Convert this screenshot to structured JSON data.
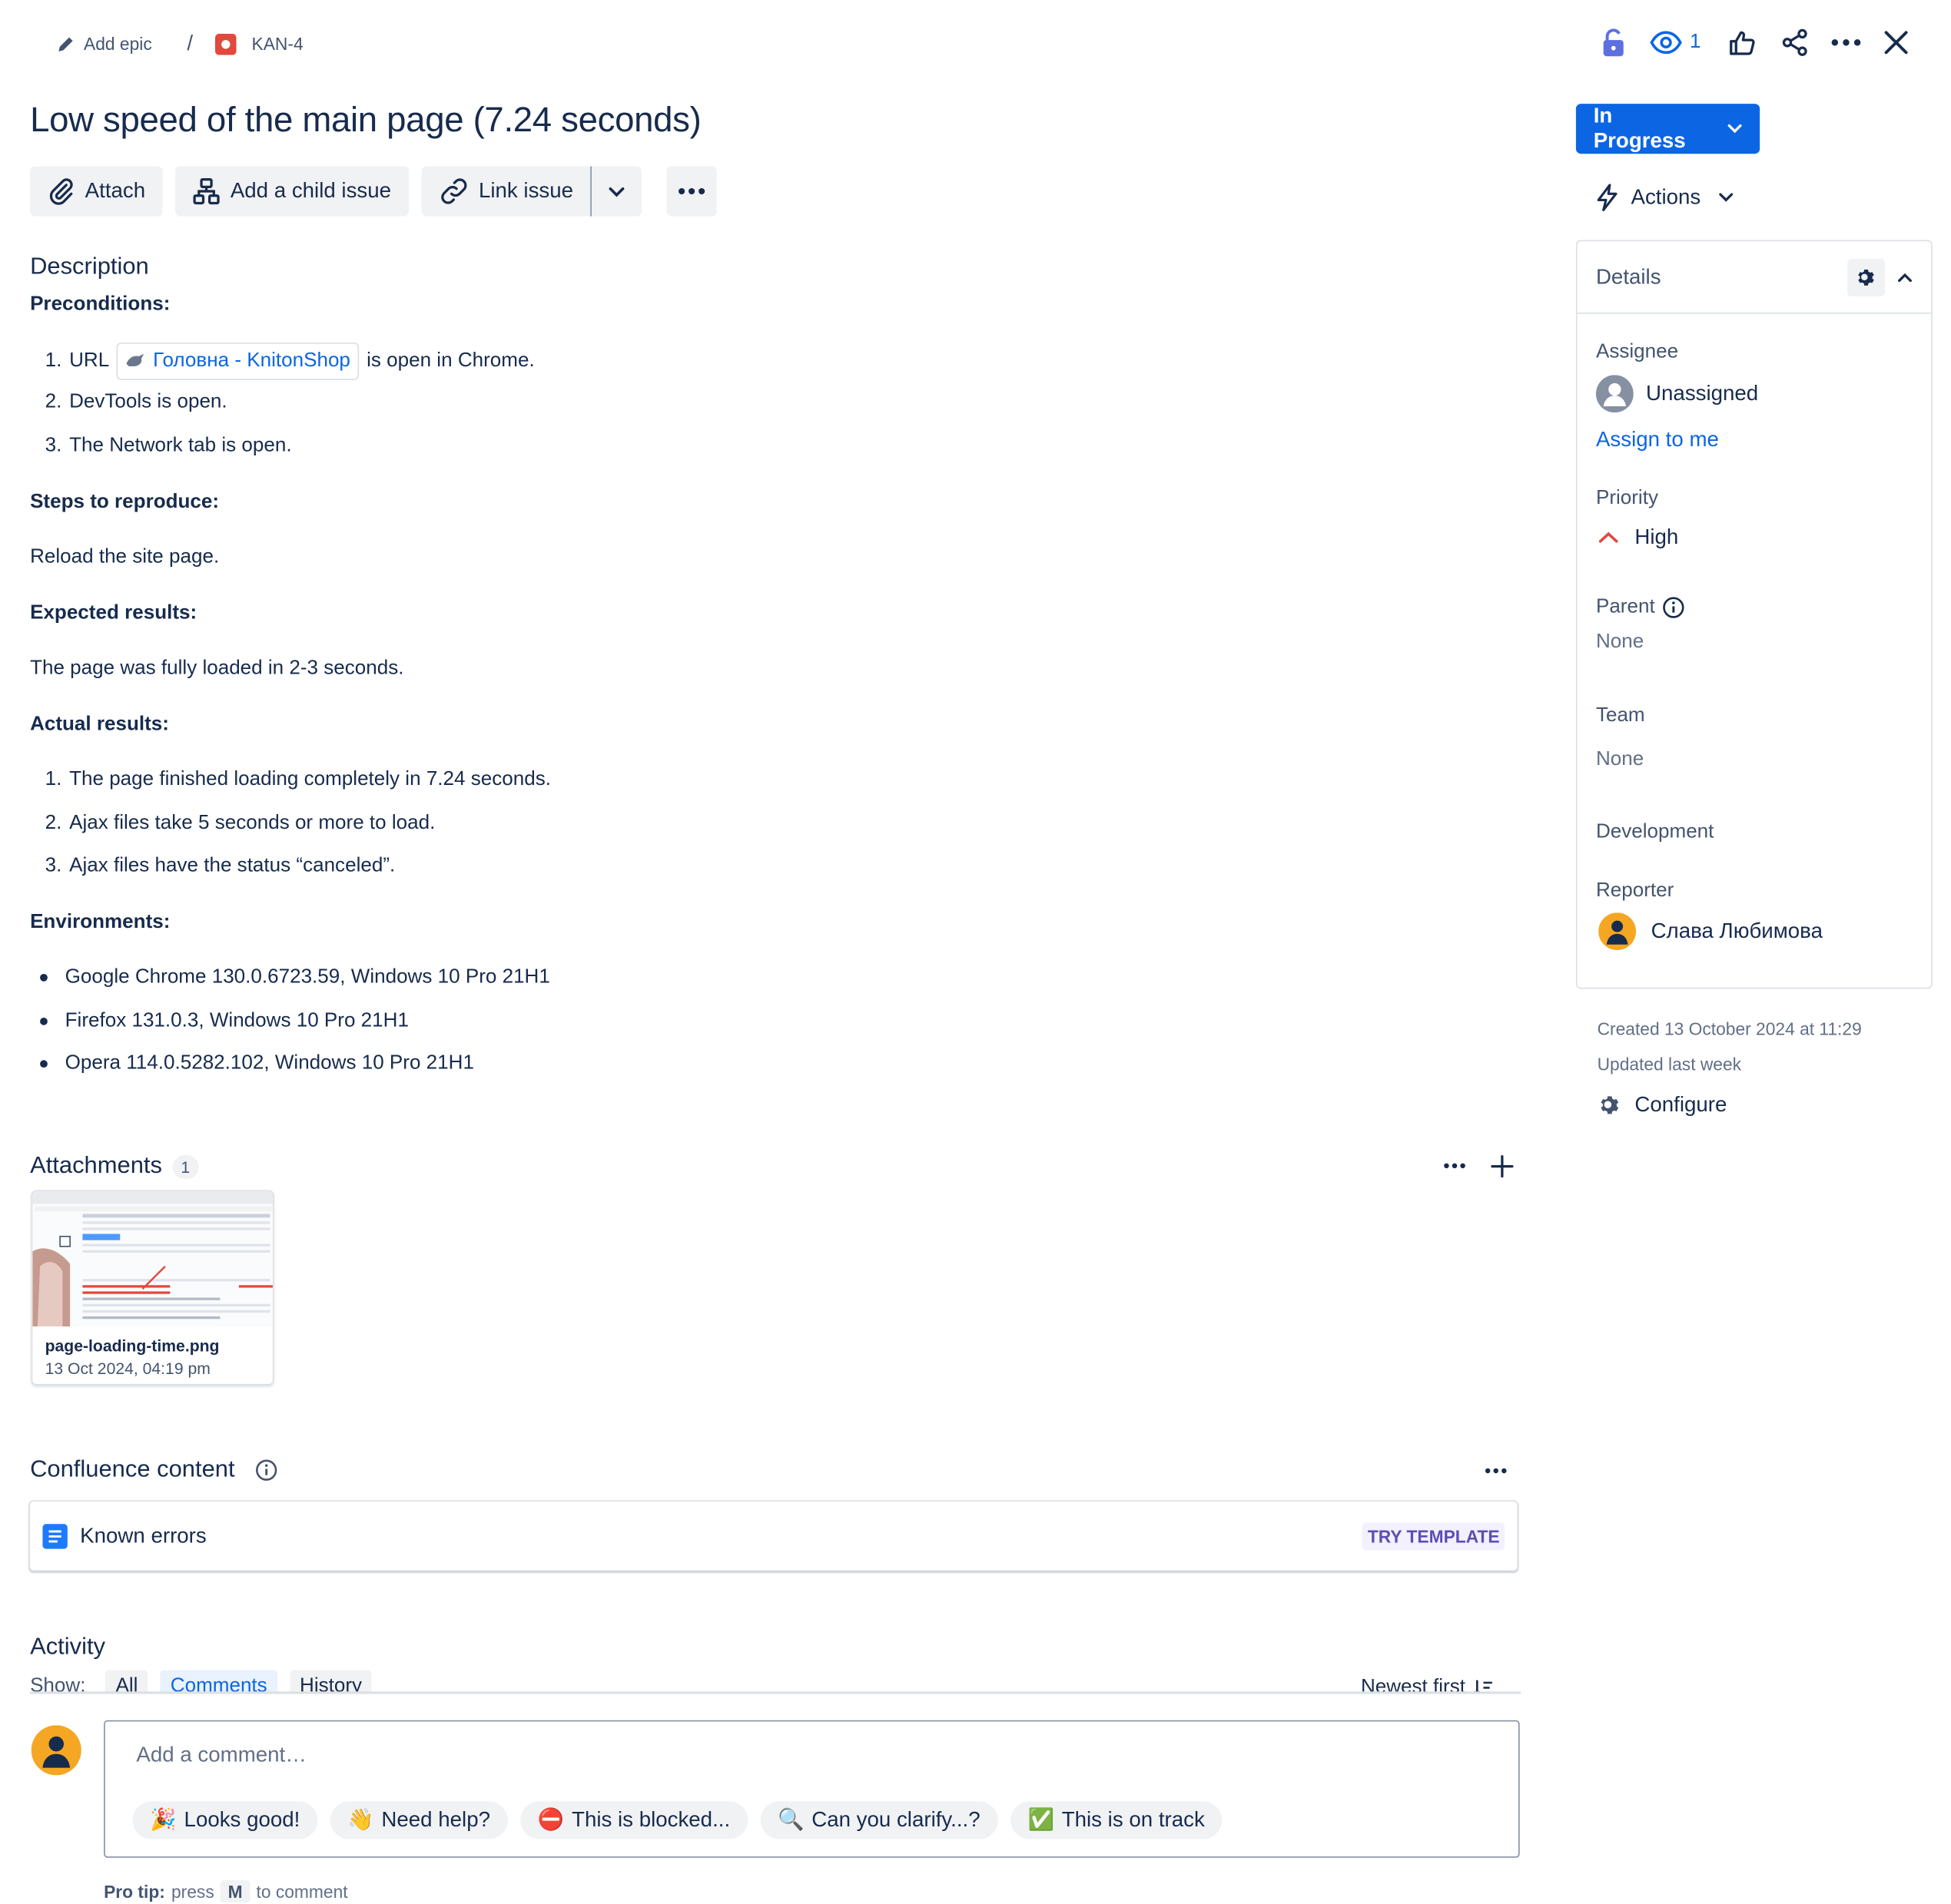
{
  "breadcrumb": {
    "add_epic": "Add epic",
    "separator": "/",
    "issue_key": "KAN-4"
  },
  "header_actions": {
    "watch_count": "1"
  },
  "issue": {
    "title": "Low speed of the main page (7.24 seconds)"
  },
  "toolbar": {
    "attach": "Attach",
    "add_child": "Add a child issue",
    "link_issue": "Link issue"
  },
  "description": {
    "heading": "Description",
    "preconditions_label": "Preconditions:",
    "pre_items": [
      {
        "num": "1.",
        "prefix": "URL",
        "link": "Головна - KnitonShop",
        "suffix": "is open in Chrome."
      },
      {
        "num": "2.",
        "text": "DevTools is open."
      },
      {
        "num": "3.",
        "text": "The Network tab is open."
      }
    ],
    "steps_label": "Steps to reproduce:",
    "steps_text": "Reload the site page.",
    "expected_label": "Expected results:",
    "expected_text": "The page was fully loaded in 2-3 seconds.",
    "actual_label": "Actual results:",
    "actual_items": [
      {
        "num": "1.",
        "text": "The page finished loading completely in 7.24 seconds."
      },
      {
        "num": "2.",
        "text": "Ajax files take 5 seconds or more to load."
      },
      {
        "num": "3.",
        "text": "Ajax files have the status “canceled”."
      }
    ],
    "env_label": "Environments:",
    "env_items": [
      "Google Chrome 130.0.6723.59, Windows 10 Pro 21H1",
      "Firefox 131.0.3, Windows 10 Pro 21H1",
      "Opera 114.0.5282.102, Windows 10 Pro 21H1"
    ]
  },
  "attachments": {
    "heading": "Attachments",
    "count": "1",
    "file": {
      "name": "page-loading-time.png",
      "date": "13 Oct 2024, 04:19 pm"
    }
  },
  "confluence": {
    "heading": "Confluence content",
    "item": "Known errors",
    "try_template": "TRY TEMPLATE"
  },
  "activity": {
    "heading": "Activity",
    "show_label": "Show:",
    "tabs": [
      "All",
      "Comments",
      "History"
    ],
    "active_tab": "Comments",
    "sort": "Newest first",
    "comment_placeholder": "Add a comment…",
    "quick_replies": [
      {
        "emoji": "🎉",
        "text": "Looks good!"
      },
      {
        "emoji": "👋",
        "text": "Need help?"
      },
      {
        "emoji": "⛔",
        "text": "This is blocked..."
      },
      {
        "emoji": "🔍",
        "text": "Can you clarify...?"
      },
      {
        "emoji": "✅",
        "text": "This is on track"
      }
    ],
    "pro_tip_label": "Pro tip:",
    "pro_tip_press": "press",
    "pro_tip_key": "M",
    "pro_tip_suffix": "to comment"
  },
  "sidebar": {
    "status": "In Progress",
    "actions": "Actions",
    "details_title": "Details",
    "assignee_label": "Assignee",
    "assignee_value": "Unassigned",
    "assign_to_me": "Assign to me",
    "priority_label": "Priority",
    "priority_value": "High",
    "parent_label": "Parent",
    "parent_value": "None",
    "team_label": "Team",
    "team_value": "None",
    "development_label": "Development",
    "reporter_label": "Reporter",
    "reporter_value": "Слава Любимова",
    "created": "Created 13 October 2024 at 11:29",
    "updated": "Updated last week",
    "configure": "Configure"
  },
  "colors": {
    "accent": "#0c66e4",
    "priority_high": "#e2483d",
    "lock": "#5e6fe0",
    "avatar_orange": "#f5a623"
  }
}
